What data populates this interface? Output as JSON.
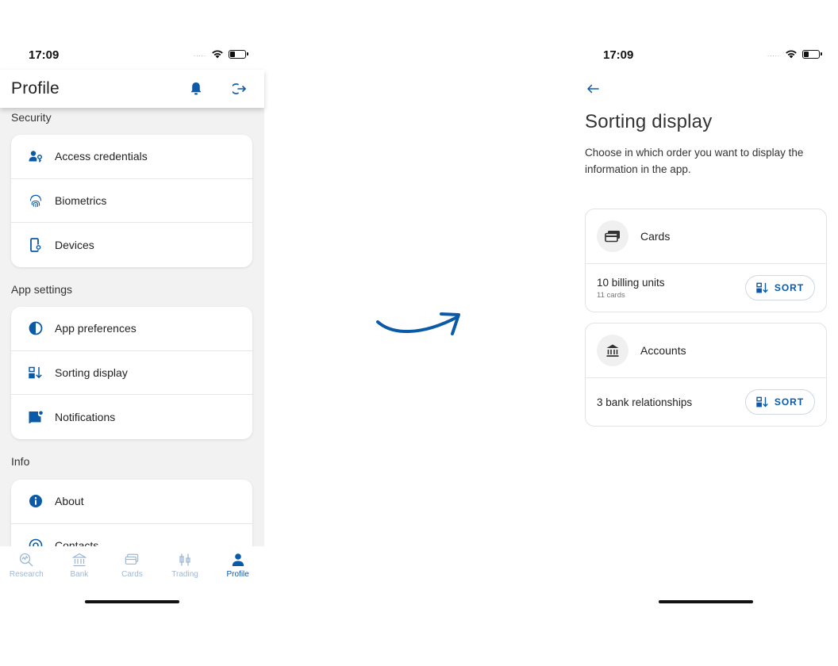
{
  "status_bar": {
    "time": "17:09",
    "signal": "....."
  },
  "left_screen": {
    "title": "Profile",
    "sections": [
      {
        "label": "Security",
        "items": [
          {
            "label": "Access credentials",
            "icon": "user-key-icon"
          },
          {
            "label": "Biometrics",
            "icon": "fingerprint-icon"
          },
          {
            "label": "Devices",
            "icon": "device-settings-icon"
          }
        ]
      },
      {
        "label": "App settings",
        "items": [
          {
            "label": "App preferences",
            "icon": "contrast-icon"
          },
          {
            "label": "Sorting display",
            "icon": "sort-icon"
          },
          {
            "label": "Notifications",
            "icon": "notification-badge-icon"
          }
        ]
      },
      {
        "label": "Info",
        "items": [
          {
            "label": "About",
            "icon": "info-icon"
          },
          {
            "label": "Contacts",
            "icon": "contacts-icon"
          }
        ]
      }
    ],
    "tabs": [
      {
        "label": "Research",
        "active": false
      },
      {
        "label": "Bank",
        "active": false
      },
      {
        "label": "Cards",
        "active": false
      },
      {
        "label": "Trading",
        "active": false
      },
      {
        "label": "Profile",
        "active": true
      }
    ]
  },
  "right_screen": {
    "title": "Sorting display",
    "description": "Choose in which order you want to display the information in the app.",
    "cards": [
      {
        "title": "Cards",
        "icon": "cards-icon",
        "main": "10 billing units",
        "sub": "11 cards",
        "button": "SORT"
      },
      {
        "title": "Accounts",
        "icon": "bank-icon",
        "main": "3 bank relationships",
        "sub": "",
        "button": "SORT"
      }
    ]
  },
  "colors": {
    "accent": "#0a5aa8",
    "background": "#f2f2f2",
    "tab_inactive": "#9db8d6"
  }
}
